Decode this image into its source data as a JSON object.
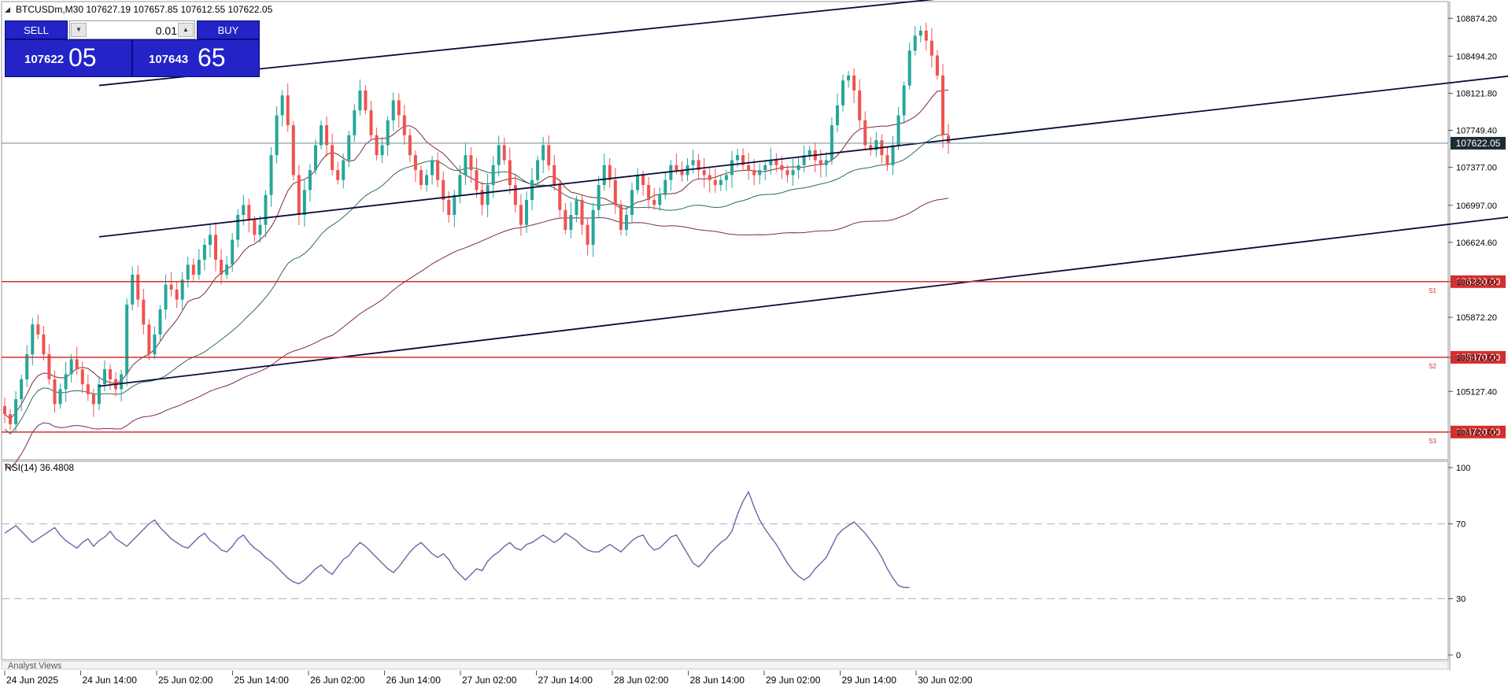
{
  "header": {
    "symbol_info": "BTCUSDm,M30  107627.19 107657.85 107612.55 107622.05"
  },
  "trade_panel": {
    "sell_label": "SELL",
    "buy_label": "BUY",
    "lot": "0.01",
    "sell_price_main": "107622",
    "sell_price_big": "05",
    "buy_price_main": "107643",
    "buy_price_big": "65"
  },
  "current_price_label": "107622.05",
  "levels": [
    {
      "name": "S1",
      "label": "106230.00",
      "value": 106230
    },
    {
      "name": "S2",
      "label": "105470.00",
      "value": 105470
    },
    {
      "name": "S3",
      "label": "104720.00",
      "value": 104720
    }
  ],
  "rsi": {
    "title": "RSI(14) 36.4808",
    "levels": [
      "100",
      "70",
      "30",
      "0"
    ],
    "values": [
      65,
      67,
      69,
      66,
      63,
      60,
      62,
      64,
      66,
      68,
      64,
      61,
      59,
      57,
      60,
      62,
      58,
      61,
      63,
      66,
      62,
      60,
      58,
      61,
      64,
      67,
      70,
      72,
      68,
      65,
      62,
      60,
      58,
      57,
      60,
      63,
      65,
      61,
      59,
      56,
      55,
      58,
      62,
      64,
      60,
      57,
      55,
      52,
      50,
      47,
      44,
      41,
      39,
      38,
      40,
      43,
      46,
      48,
      45,
      43,
      47,
      51,
      53,
      57,
      60,
      58,
      55,
      52,
      49,
      46,
      44,
      47,
      51,
      55,
      58,
      60,
      57,
      54,
      52,
      54,
      51,
      46,
      43,
      40,
      43,
      46,
      45,
      50,
      53,
      55,
      58,
      60,
      57,
      56,
      59,
      60,
      62,
      64,
      62,
      60,
      62,
      65,
      63,
      61,
      58,
      56,
      55,
      55,
      57,
      59,
      57,
      55,
      58,
      61,
      63,
      64,
      59,
      56,
      57,
      60,
      63,
      64,
      59,
      54,
      49,
      47,
      50,
      54,
      57,
      60,
      62,
      66,
      75,
      82,
      87,
      79,
      72,
      67,
      63,
      59,
      54,
      49,
      45,
      42,
      40,
      42,
      46,
      49,
      52,
      58,
      64,
      67,
      69,
      71,
      68,
      65,
      61,
      57,
      52,
      46,
      41,
      37,
      36,
      36
    ],
    "x_labels": [
      "24 Jun 2025",
      "24 Jun 14:00",
      "25 Jun 02:00",
      "25 Jun 14:00",
      "26 Jun 02:00",
      "26 Jun 14:00",
      "27 Jun 02:00",
      "27 Jun 14:00",
      "28 Jun 02:00",
      "28 Jun 14:00",
      "29 Jun 02:00",
      "29 Jun 14:00",
      "30 Jun 02:00"
    ]
  },
  "footer_label": "Analyst Views",
  "colors": {
    "bull": "#26a69a",
    "bear": "#ef5350",
    "channel": "#0a0a3a",
    "support": "#d32f2f",
    "rsi": "#7b5ea7",
    "ma_slow": "#7a2a55",
    "ma_mid": "#2e6b57",
    "ma_fast": "#7a2a3a"
  },
  "chart_data": {
    "type": "candlestick",
    "symbol": "BTCUSDm",
    "timeframe": "M30",
    "ylim": [
      104600,
      108900
    ],
    "y_ticks": [
      108874.2,
      108494.2,
      108121.8,
      107749.4,
      107377,
      106997,
      106624.6,
      106230,
      105872.2,
      105470,
      105127.4,
      104720
    ],
    "x_labels": [
      "24 Jun 2025",
      "24 Jun 14:00",
      "25 Jun 02:00",
      "25 Jun 14:00",
      "26 Jun 02:00",
      "26 Jun 14:00",
      "27 Jun 02:00",
      "27 Jun 14:00",
      "28 Jun 02:00",
      "28 Jun 14:00",
      "29 Jun 02:00",
      "29 Jun 14:00",
      "30 Jun 02:00"
    ],
    "close": [
      104900,
      104800,
      105050,
      105250,
      105500,
      105800,
      105700,
      105500,
      105250,
      105000,
      105150,
      105300,
      105450,
      105350,
      105200,
      105100,
      105000,
      105200,
      105350,
      105250,
      105150,
      105300,
      106000,
      106300,
      106050,
      105800,
      105500,
      105700,
      105950,
      106200,
      106150,
      106050,
      106250,
      106400,
      106300,
      106450,
      106600,
      106700,
      106450,
      106300,
      106400,
      106650,
      106900,
      107000,
      106850,
      106700,
      106800,
      107100,
      107500,
      107900,
      108100,
      107800,
      107300,
      106900,
      107150,
      107350,
      107600,
      107800,
      107600,
      107350,
      107250,
      107450,
      107700,
      107950,
      108150,
      107950,
      107700,
      107500,
      107600,
      107850,
      108050,
      107900,
      107700,
      107500,
      107350,
      107200,
      107300,
      107450,
      107250,
      107050,
      106900,
      107100,
      107300,
      107500,
      107350,
      107150,
      107000,
      107200,
      107400,
      107600,
      107450,
      107200,
      107000,
      106800,
      107050,
      107250,
      107450,
      107600,
      107400,
      107200,
      106950,
      106750,
      106900,
      107050,
      106800,
      106600,
      106950,
      107200,
      107400,
      107250,
      107000,
      106750,
      106900,
      107150,
      107300,
      107200,
      107050,
      107000,
      107100,
      107250,
      107400,
      107350,
      107300,
      107400,
      107450,
      107350,
      107300,
      107250,
      107200,
      107250,
      107300,
      107450,
      107500,
      107400,
      107350,
      107300,
      107350,
      107400,
      107450,
      107400,
      107350,
      107300,
      107350,
      107400,
      107500,
      107550,
      107450,
      107400,
      107450,
      107800,
      108000,
      108250,
      108300,
      108150,
      107850,
      107600,
      107550,
      107650,
      107500,
      107400,
      107600,
      107900,
      108200,
      108550,
      108700,
      108750,
      108650,
      108500,
      108300,
      107700,
      107620
    ]
  }
}
